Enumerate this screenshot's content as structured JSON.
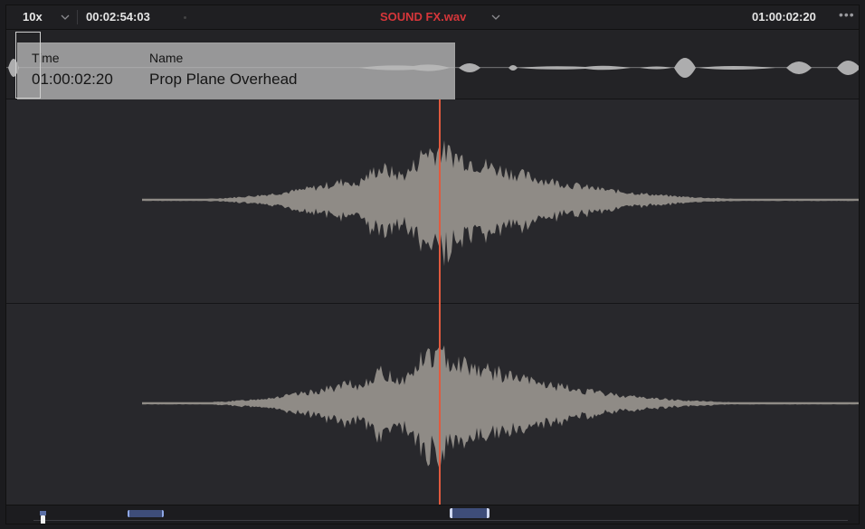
{
  "header": {
    "zoom_label": "10x",
    "source_timecode": "00:02:54:03",
    "clip_title": "SOUND FX.wav",
    "record_timecode": "01:00:02:20",
    "more_label": "•••"
  },
  "marker_popup": {
    "time_header": "Time",
    "name_header": "Name",
    "time_value": "01:00:02:20",
    "name_value": "Prop Plane Overhead"
  },
  "colors": {
    "clip_title": "#d6363a",
    "playhead": "#e05a3e",
    "waveform": "#8f8b86",
    "overview_waveform": "#bdbdbd",
    "range_handle": "#8fa8e6"
  },
  "icons": [
    "zoom-chevron-icon",
    "title-chevron-icon",
    "more-options-icon"
  ]
}
